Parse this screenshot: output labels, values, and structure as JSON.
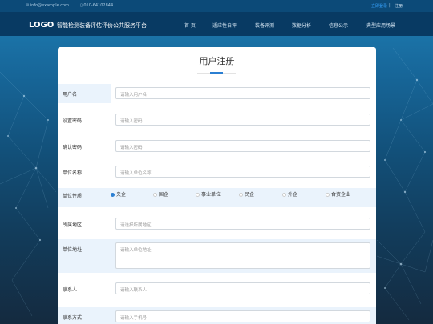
{
  "topbar": {
    "email": "info@example.com",
    "phone": "010-64102844",
    "login": "立即登录",
    "divider": "|",
    "register": "注册"
  },
  "nav": {
    "logo": "LOGO",
    "platform_name": "智能检测装备评估评价公共服务平台",
    "items": [
      "首 页",
      "适应性自评",
      "装备评测",
      "数据分析",
      "信息公示",
      "典型应用场景"
    ]
  },
  "form": {
    "title": "用户注册",
    "fields": {
      "username": {
        "label": "用户名",
        "placeholder": "请输入用户名"
      },
      "password": {
        "label": "设置密码",
        "placeholder": "请输入密码"
      },
      "confirm": {
        "label": "确认密码",
        "placeholder": "请输入密码"
      },
      "company": {
        "label": "单位名称",
        "placeholder": "请输入单位名称"
      },
      "nature": {
        "label": "单位性质",
        "options": [
          "央企",
          "国企",
          "事业单位",
          "民企",
          "外企",
          "合资企业"
        ],
        "selected": "央企"
      },
      "region": {
        "label": "所属地区",
        "placeholder": "请选择所属地区"
      },
      "address": {
        "label": "单位地址",
        "placeholder": "请输入单位地址"
      },
      "contact": {
        "label": "联系人",
        "placeholder": "请输入联系人"
      },
      "phone": {
        "label": "联系方式",
        "placeholder": "请输入手机号"
      }
    }
  }
}
